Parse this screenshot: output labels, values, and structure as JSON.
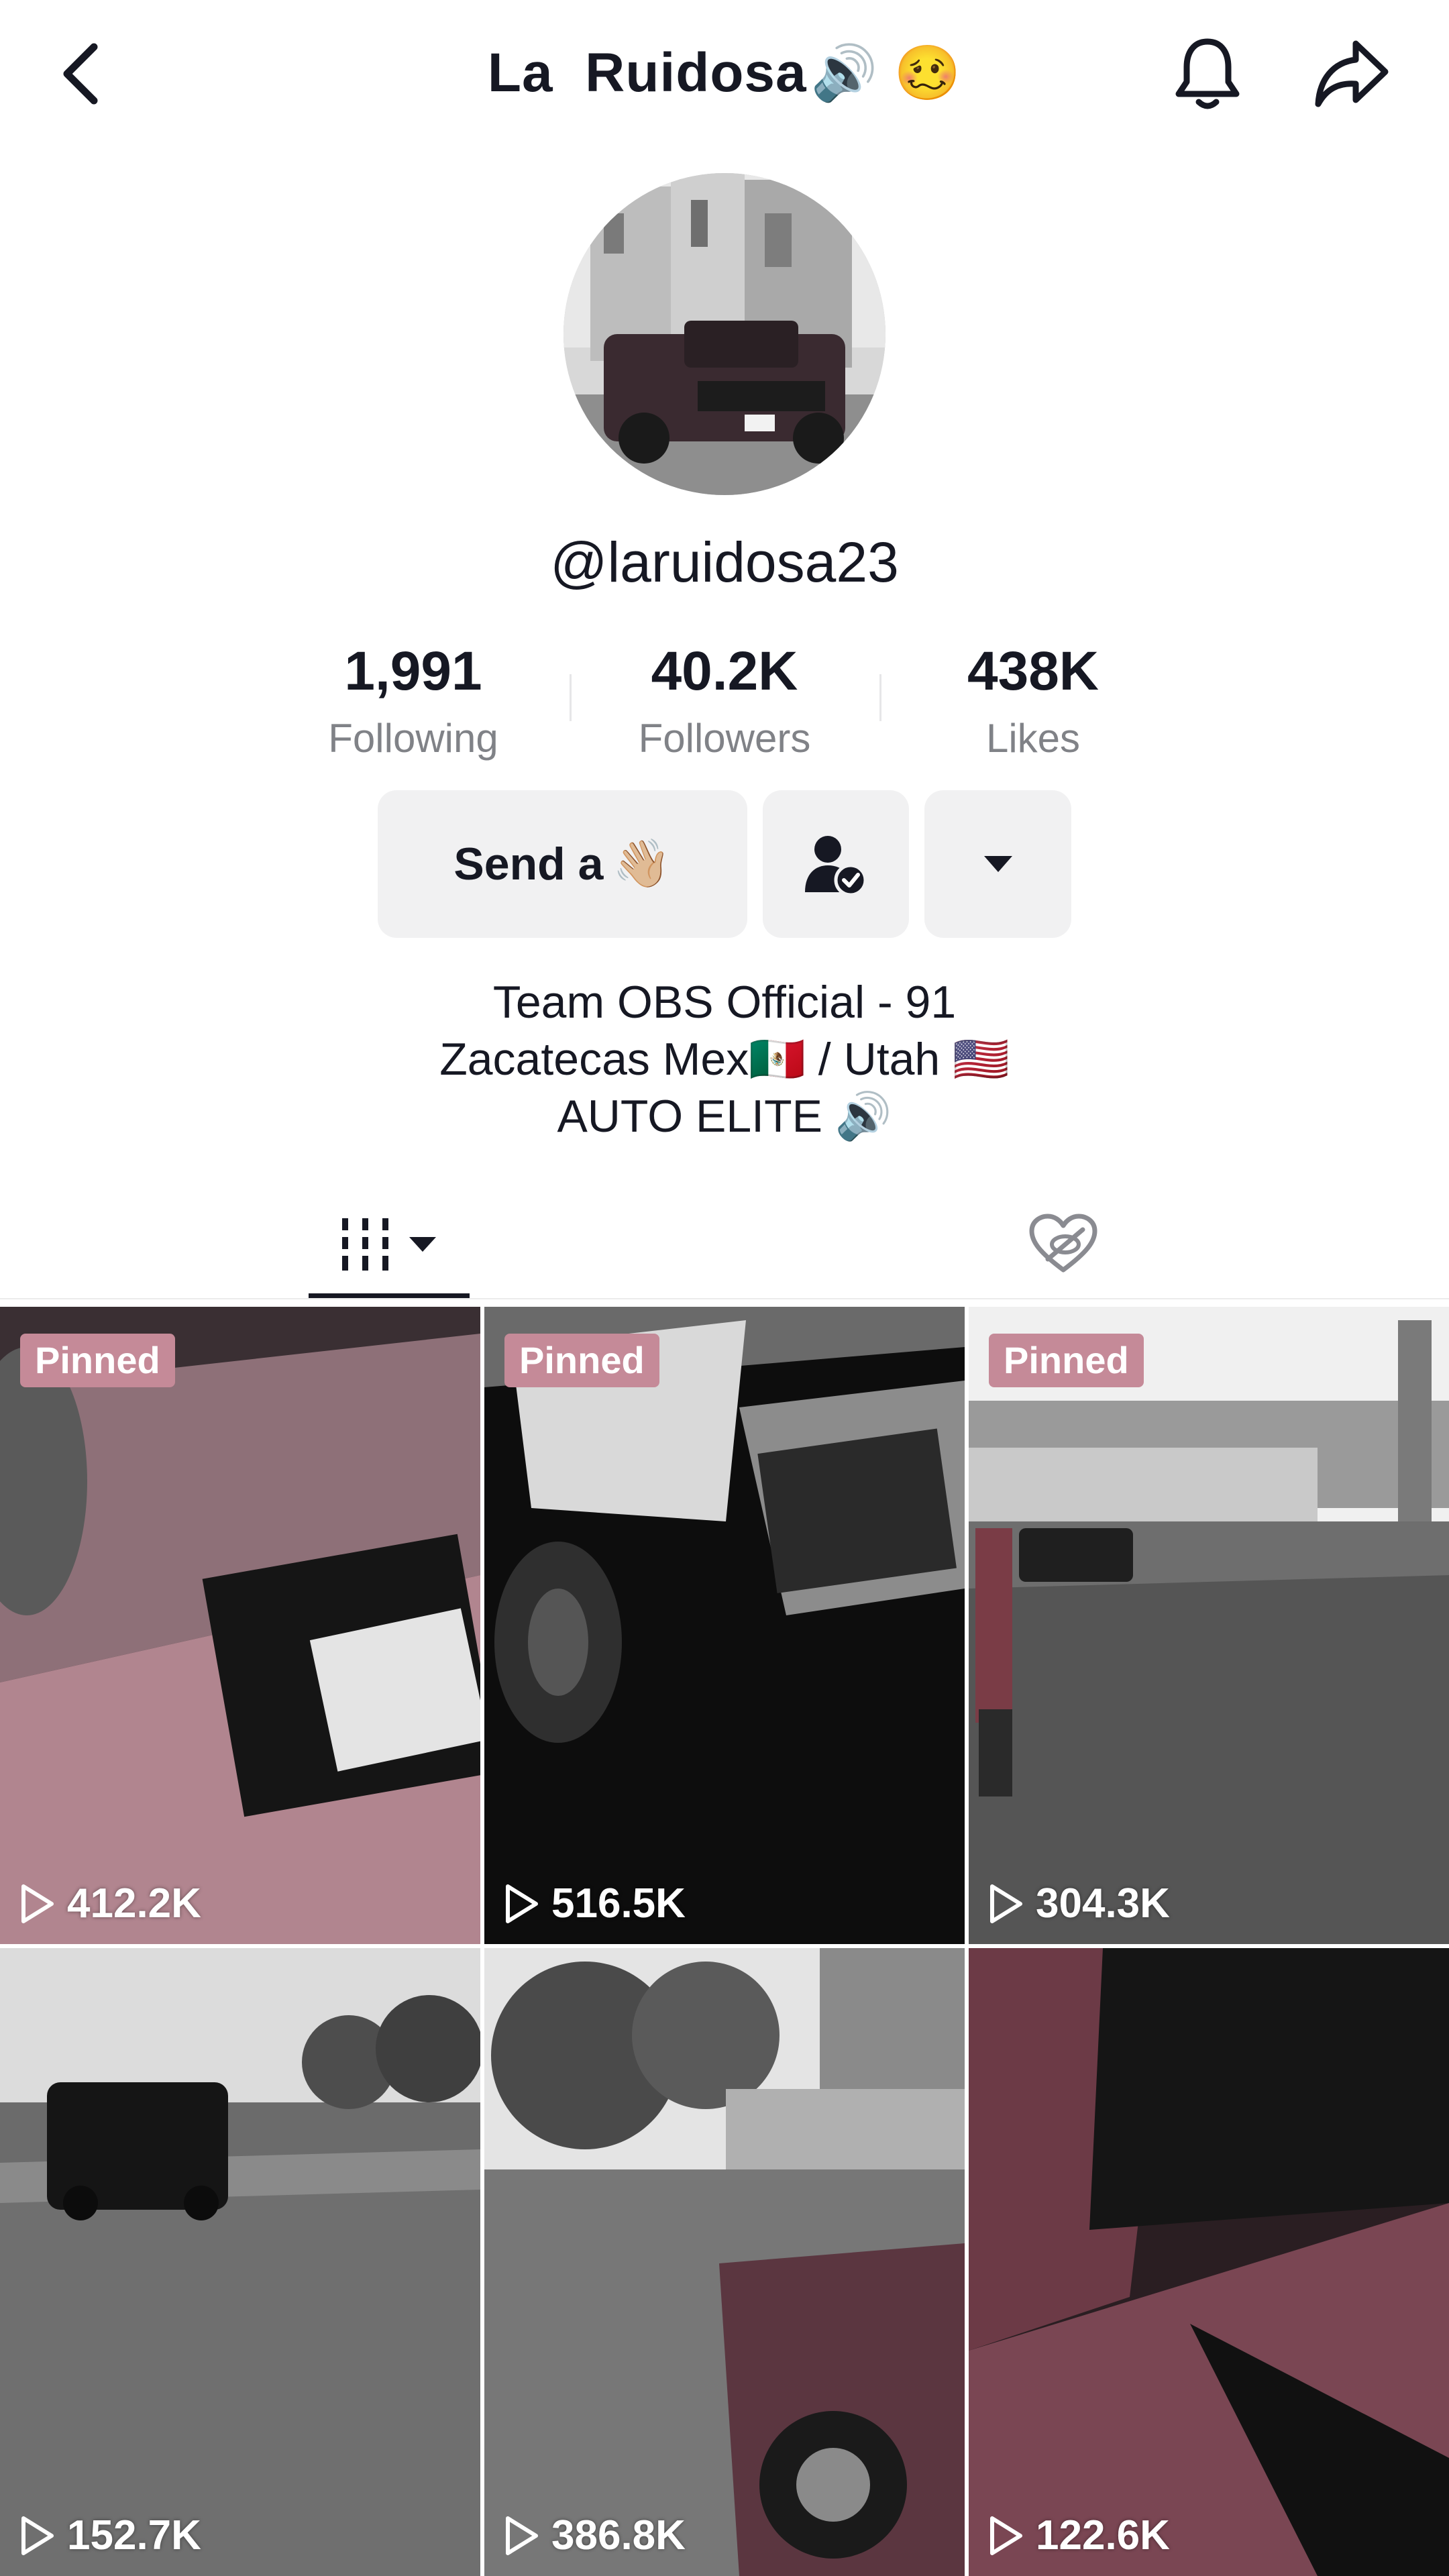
{
  "header": {
    "title": "La  Ruidosa",
    "title_emoji": "🔊 🥴",
    "icons": {
      "back": "chevron-left-icon",
      "bell": "bell-icon",
      "share": "share-arrow-icon"
    }
  },
  "profile": {
    "handle": "@laruidosa23",
    "stats": [
      {
        "value": "1,991",
        "label": "Following"
      },
      {
        "value": "40.2K",
        "label": "Followers"
      },
      {
        "value": "438K",
        "label": "Likes"
      }
    ]
  },
  "actions": {
    "send_label": "Send a",
    "send_emoji": "👋🏼",
    "friend_icon": "user-check-icon",
    "more_icon": "caret-down-icon"
  },
  "bio": {
    "line1": "Team OBS Official - 91",
    "line2": "Zacatecas Mex🇲🇽 / Utah 🇺🇸",
    "line3": "AUTO ELITE 🔊"
  },
  "tabs": {
    "videos_icon": "grid-bars-icon",
    "liked_icon": "liked-hidden-heart-icon"
  },
  "videos": [
    {
      "pinned": "Pinned",
      "views": "412.2K"
    },
    {
      "pinned": "Pinned",
      "views": "516.5K"
    },
    {
      "pinned": "Pinned",
      "views": "304.3K"
    },
    {
      "pinned": "",
      "views": "152.7K"
    },
    {
      "pinned": "",
      "views": "386.8K"
    },
    {
      "pinned": "",
      "views": "122.6K"
    }
  ],
  "colors": {
    "pinned_badge": "#c58a98",
    "text": "#161823",
    "secondary_text": "#808287",
    "button_bg": "#f1f1f2"
  }
}
